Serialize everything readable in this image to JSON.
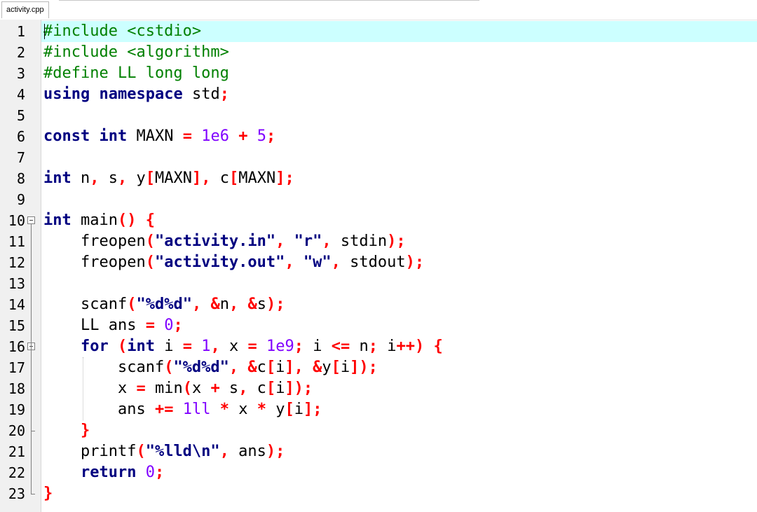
{
  "tab": {
    "title": "activity.cpp"
  },
  "colors": {
    "preprocessor": "#008000",
    "keyword": "#000080",
    "operator": "#ff0000",
    "number": "#8000ff",
    "string": "#000080",
    "current_line": "#ccffff",
    "gutter": "#f0f0f0"
  },
  "editor": {
    "current_line": 1,
    "lines": [
      {
        "num": "1",
        "fold": "",
        "tokens": [
          {
            "t": "pp",
            "v": "#include <cstdio>"
          }
        ]
      },
      {
        "num": "2",
        "fold": "",
        "tokens": [
          {
            "t": "pp",
            "v": "#include <algorithm>"
          }
        ]
      },
      {
        "num": "3",
        "fold": "",
        "tokens": [
          {
            "t": "pp",
            "v": "#define LL long long"
          }
        ]
      },
      {
        "num": "4",
        "fold": "",
        "tokens": [
          {
            "t": "kw",
            "v": "using"
          },
          {
            "t": "id",
            "v": " "
          },
          {
            "t": "kw",
            "v": "namespace"
          },
          {
            "t": "id",
            "v": " std"
          },
          {
            "t": "op",
            "v": ";"
          }
        ]
      },
      {
        "num": "5",
        "fold": "",
        "tokens": []
      },
      {
        "num": "6",
        "fold": "",
        "tokens": [
          {
            "t": "kw",
            "v": "const"
          },
          {
            "t": "id",
            "v": " "
          },
          {
            "t": "kw",
            "v": "int"
          },
          {
            "t": "id",
            "v": " MAXN "
          },
          {
            "t": "op",
            "v": "="
          },
          {
            "t": "id",
            "v": " "
          },
          {
            "t": "num",
            "v": "1e6"
          },
          {
            "t": "id",
            "v": " "
          },
          {
            "t": "op",
            "v": "+"
          },
          {
            "t": "id",
            "v": " "
          },
          {
            "t": "num",
            "v": "5"
          },
          {
            "t": "op",
            "v": ";"
          }
        ]
      },
      {
        "num": "7",
        "fold": "",
        "tokens": []
      },
      {
        "num": "8",
        "fold": "",
        "tokens": [
          {
            "t": "kw",
            "v": "int"
          },
          {
            "t": "id",
            "v": " n"
          },
          {
            "t": "op",
            "v": ","
          },
          {
            "t": "id",
            "v": " s"
          },
          {
            "t": "op",
            "v": ","
          },
          {
            "t": "id",
            "v": " y"
          },
          {
            "t": "op",
            "v": "["
          },
          {
            "t": "id",
            "v": "MAXN"
          },
          {
            "t": "op",
            "v": "],"
          },
          {
            "t": "id",
            "v": " c"
          },
          {
            "t": "op",
            "v": "["
          },
          {
            "t": "id",
            "v": "MAXN"
          },
          {
            "t": "op",
            "v": "];"
          }
        ]
      },
      {
        "num": "9",
        "fold": "",
        "tokens": []
      },
      {
        "num": "10",
        "fold": "open",
        "tokens": [
          {
            "t": "kw",
            "v": "int"
          },
          {
            "t": "id",
            "v": " main"
          },
          {
            "t": "op",
            "v": "()"
          },
          {
            "t": "id",
            "v": " "
          },
          {
            "t": "op",
            "v": "{"
          }
        ]
      },
      {
        "num": "11",
        "fold": "",
        "tokens": [
          {
            "t": "id",
            "v": "    freopen"
          },
          {
            "t": "op",
            "v": "("
          },
          {
            "t": "str",
            "v": "\"activity.in\""
          },
          {
            "t": "op",
            "v": ","
          },
          {
            "t": "id",
            "v": " "
          },
          {
            "t": "str",
            "v": "\"r\""
          },
          {
            "t": "op",
            "v": ","
          },
          {
            "t": "id",
            "v": " stdin"
          },
          {
            "t": "op",
            "v": ");"
          }
        ]
      },
      {
        "num": "12",
        "fold": "",
        "tokens": [
          {
            "t": "id",
            "v": "    freopen"
          },
          {
            "t": "op",
            "v": "("
          },
          {
            "t": "str",
            "v": "\"activity.out\""
          },
          {
            "t": "op",
            "v": ","
          },
          {
            "t": "id",
            "v": " "
          },
          {
            "t": "str",
            "v": "\"w\""
          },
          {
            "t": "op",
            "v": ","
          },
          {
            "t": "id",
            "v": " stdout"
          },
          {
            "t": "op",
            "v": ");"
          }
        ]
      },
      {
        "num": "13",
        "fold": "",
        "tokens": []
      },
      {
        "num": "14",
        "fold": "",
        "tokens": [
          {
            "t": "id",
            "v": "    scanf"
          },
          {
            "t": "op",
            "v": "("
          },
          {
            "t": "str",
            "v": "\"%d%d\""
          },
          {
            "t": "op",
            "v": ","
          },
          {
            "t": "id",
            "v": " "
          },
          {
            "t": "op",
            "v": "&"
          },
          {
            "t": "id",
            "v": "n"
          },
          {
            "t": "op",
            "v": ","
          },
          {
            "t": "id",
            "v": " "
          },
          {
            "t": "op",
            "v": "&"
          },
          {
            "t": "id",
            "v": "s"
          },
          {
            "t": "op",
            "v": ");"
          }
        ]
      },
      {
        "num": "15",
        "fold": "",
        "tokens": [
          {
            "t": "id",
            "v": "    LL ans "
          },
          {
            "t": "op",
            "v": "="
          },
          {
            "t": "id",
            "v": " "
          },
          {
            "t": "num",
            "v": "0"
          },
          {
            "t": "op",
            "v": ";"
          }
        ]
      },
      {
        "num": "16",
        "fold": "open",
        "tokens": [
          {
            "t": "id",
            "v": "    "
          },
          {
            "t": "kw",
            "v": "for"
          },
          {
            "t": "id",
            "v": " "
          },
          {
            "t": "op",
            "v": "("
          },
          {
            "t": "kw",
            "v": "int"
          },
          {
            "t": "id",
            "v": " i "
          },
          {
            "t": "op",
            "v": "="
          },
          {
            "t": "id",
            "v": " "
          },
          {
            "t": "num",
            "v": "1"
          },
          {
            "t": "op",
            "v": ","
          },
          {
            "t": "id",
            "v": " x "
          },
          {
            "t": "op",
            "v": "="
          },
          {
            "t": "id",
            "v": " "
          },
          {
            "t": "num",
            "v": "1e9"
          },
          {
            "t": "op",
            "v": ";"
          },
          {
            "t": "id",
            "v": " i "
          },
          {
            "t": "op",
            "v": "<="
          },
          {
            "t": "id",
            "v": " n"
          },
          {
            "t": "op",
            "v": ";"
          },
          {
            "t": "id",
            "v": " i"
          },
          {
            "t": "op",
            "v": "++)"
          },
          {
            "t": "id",
            "v": " "
          },
          {
            "t": "op",
            "v": "{"
          }
        ]
      },
      {
        "num": "17",
        "fold": "",
        "tokens": [
          {
            "t": "id",
            "v": "        scanf"
          },
          {
            "t": "op",
            "v": "("
          },
          {
            "t": "str",
            "v": "\"%d%d\""
          },
          {
            "t": "op",
            "v": ","
          },
          {
            "t": "id",
            "v": " "
          },
          {
            "t": "op",
            "v": "&"
          },
          {
            "t": "id",
            "v": "c"
          },
          {
            "t": "op",
            "v": "["
          },
          {
            "t": "id",
            "v": "i"
          },
          {
            "t": "op",
            "v": "],"
          },
          {
            "t": "id",
            "v": " "
          },
          {
            "t": "op",
            "v": "&"
          },
          {
            "t": "id",
            "v": "y"
          },
          {
            "t": "op",
            "v": "["
          },
          {
            "t": "id",
            "v": "i"
          },
          {
            "t": "op",
            "v": "]);"
          }
        ]
      },
      {
        "num": "18",
        "fold": "",
        "tokens": [
          {
            "t": "id",
            "v": "        x "
          },
          {
            "t": "op",
            "v": "="
          },
          {
            "t": "id",
            "v": " min"
          },
          {
            "t": "op",
            "v": "("
          },
          {
            "t": "id",
            "v": "x "
          },
          {
            "t": "op",
            "v": "+"
          },
          {
            "t": "id",
            "v": " s"
          },
          {
            "t": "op",
            "v": ","
          },
          {
            "t": "id",
            "v": " c"
          },
          {
            "t": "op",
            "v": "["
          },
          {
            "t": "id",
            "v": "i"
          },
          {
            "t": "op",
            "v": "]);"
          }
        ]
      },
      {
        "num": "19",
        "fold": "",
        "tokens": [
          {
            "t": "id",
            "v": "        ans "
          },
          {
            "t": "op",
            "v": "+="
          },
          {
            "t": "id",
            "v": " "
          },
          {
            "t": "num",
            "v": "1ll"
          },
          {
            "t": "id",
            "v": " "
          },
          {
            "t": "op",
            "v": "*"
          },
          {
            "t": "id",
            "v": " x "
          },
          {
            "t": "op",
            "v": "*"
          },
          {
            "t": "id",
            "v": " y"
          },
          {
            "t": "op",
            "v": "["
          },
          {
            "t": "id",
            "v": "i"
          },
          {
            "t": "op",
            "v": "];"
          }
        ]
      },
      {
        "num": "20",
        "fold": "end",
        "tokens": [
          {
            "t": "id",
            "v": "    "
          },
          {
            "t": "op",
            "v": "}"
          }
        ]
      },
      {
        "num": "21",
        "fold": "",
        "tokens": [
          {
            "t": "id",
            "v": "    printf"
          },
          {
            "t": "op",
            "v": "("
          },
          {
            "t": "str",
            "v": "\"%lld\\n\""
          },
          {
            "t": "op",
            "v": ","
          },
          {
            "t": "id",
            "v": " ans"
          },
          {
            "t": "op",
            "v": ");"
          }
        ]
      },
      {
        "num": "22",
        "fold": "",
        "tokens": [
          {
            "t": "id",
            "v": "    "
          },
          {
            "t": "kw",
            "v": "return"
          },
          {
            "t": "id",
            "v": " "
          },
          {
            "t": "num",
            "v": "0"
          },
          {
            "t": "op",
            "v": ";"
          }
        ]
      },
      {
        "num": "23",
        "fold": "end",
        "tokens": [
          {
            "t": "op",
            "v": "}"
          }
        ]
      }
    ]
  }
}
